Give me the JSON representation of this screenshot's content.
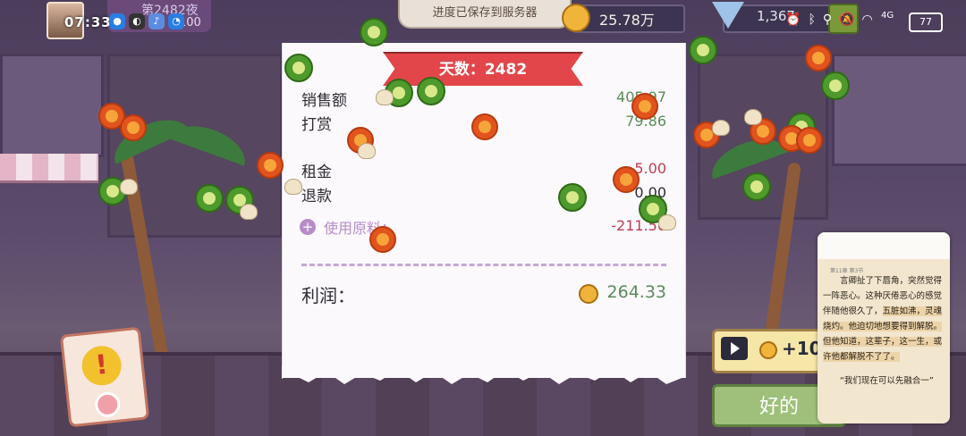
{
  "status_bar": {
    "time": "07:33",
    "network": "4G",
    "battery": "77"
  },
  "night": {
    "label": "第2482夜",
    "sub_value": "100"
  },
  "toast": "进度已保存到服务器",
  "currency": {
    "coins": "25.78万",
    "gems": "1,367"
  },
  "receipt": {
    "day_title": "天数：2482",
    "rows": [
      {
        "label": "销售额",
        "value": "405.97"
      },
      {
        "label": "打赏",
        "value": "79.86"
      },
      {
        "label": "租金",
        "value": "-5.00"
      },
      {
        "label": "退款",
        "value": "0.00"
      }
    ],
    "ingredients_label": "使用原料：",
    "ingredients_value": "-211.50",
    "profit_label": "利润：",
    "profit_value": "264.33"
  },
  "ad_button": {
    "label": "+10"
  },
  "ok_button": {
    "label": "好的"
  },
  "reader": {
    "header": "第11章 第3节",
    "paragraph1_a": "言卿扯了下唇角，突然觉得一阵恶心。这种厌倦恶心的感觉伴随他很久了，",
    "paragraph1_b": "五脏如沸，灵魂烧灼。他迫切地想要得到解脱。但他知道，这辈子，这一生，或许他都解脱不了了。",
    "paragraph2": "“我们现在可以先融合一”"
  },
  "colors": {
    "profit_green": "#5b8a5a",
    "cost_red": "#c23b55",
    "ribbon_red": "#e2464a"
  }
}
